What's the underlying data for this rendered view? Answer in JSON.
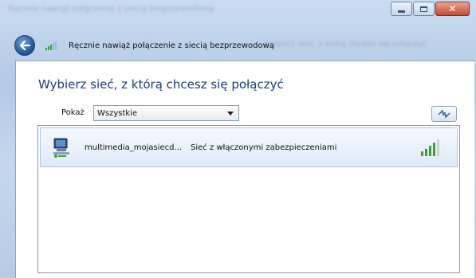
{
  "window": {
    "background_title": "Ręcznie nawiąż połączenie z siecią bezprzewodową",
    "background_hint": "Wybierz sieć, z którą chcesz się połączyć",
    "caption_buttons": [
      "minimize",
      "maximize",
      "close"
    ]
  },
  "nav": {
    "back_icon": "back-arrow-icon",
    "network_icon": "wireless-signal-icon",
    "title": "Ręcznie nawiąż połączenie z siecią bezprzewodową"
  },
  "main": {
    "heading": "Wybierz sieć, z którą chcesz się połączyć",
    "filter": {
      "label": "Pokaż",
      "selected": "Wszystkie"
    },
    "refresh_icon": "refresh-icon",
    "networks": [
      {
        "name": "multimedia_mojasiecd...",
        "security": "Sieć z włączonymi zabezpieczeniami",
        "signal_bars": 5,
        "signal_level": 0.8
      }
    ]
  },
  "colors": {
    "heading": "#1e3a87",
    "row_highlight": "#dfeaf8",
    "signal_green": "#3aa52e",
    "close_button": "#c24a35"
  }
}
